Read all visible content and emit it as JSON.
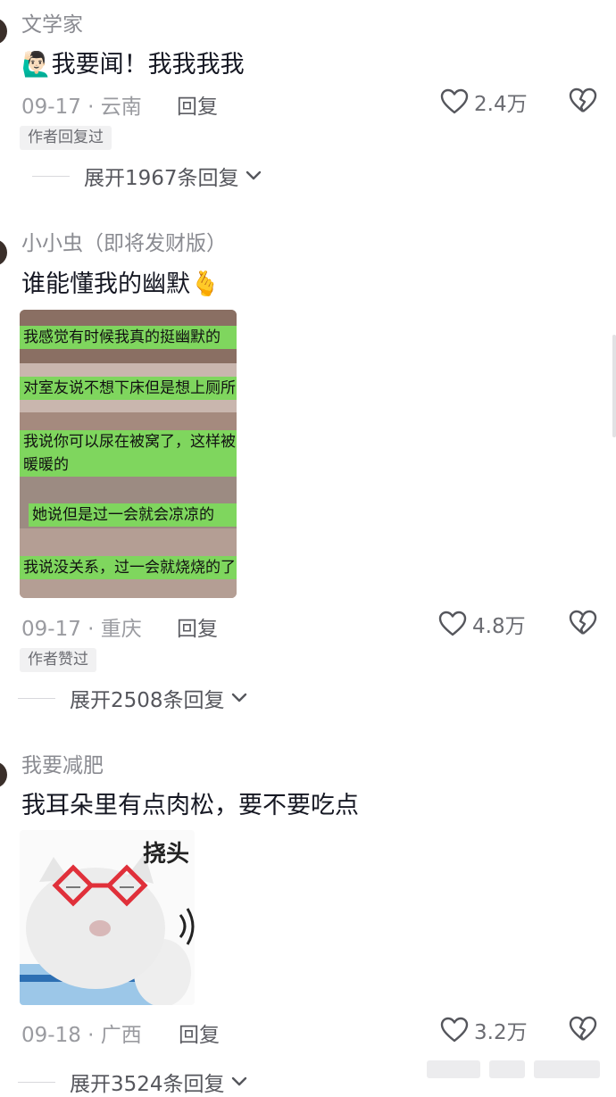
{
  "comments": [
    {
      "username": "文学家",
      "emoji": "🙋🏻‍♂️",
      "text": "我要闻！我我我我",
      "date": "09-17",
      "location": "云南",
      "reply_label": "回复",
      "like_count": "2.4万",
      "badge": "作者回复过",
      "expand_label": "展开1967条回复"
    },
    {
      "username": "小小虫（即将发财版）",
      "text": "谁能懂我的幽默",
      "emoji": "🫰",
      "date": "09-17",
      "location": "重庆",
      "reply_label": "回复",
      "like_count": "4.8万",
      "badge": "作者赞过",
      "expand_label": "展开2508条回复",
      "image": {
        "bubbles": [
          "我感觉有时候我真的挺幽默的",
          "对室友说不想下床但是想上厕所",
          "我说你可以尿在被窝了，这样被窝",
          "暖暖的",
          "她说但是过一会就会凉凉的",
          "我说没关系，过一会就烧烧的了"
        ]
      }
    },
    {
      "username": "我要减肥",
      "text": "我耳朵里有点肉松，要不要吃点",
      "date": "09-18",
      "location": "广西",
      "reply_label": "回复",
      "like_count": "3.2万",
      "expand_label": "展开3524条回复",
      "image": {
        "caption": "挠头"
      }
    }
  ],
  "separator": "·",
  "colors": {
    "bubble_green": "#7fd65e",
    "text_primary": "#161823",
    "text_secondary": "#8a8b91"
  },
  "icons": {
    "like": "heart-icon",
    "dislike": "broken-heart-icon",
    "expand": "chevron-down-icon"
  }
}
